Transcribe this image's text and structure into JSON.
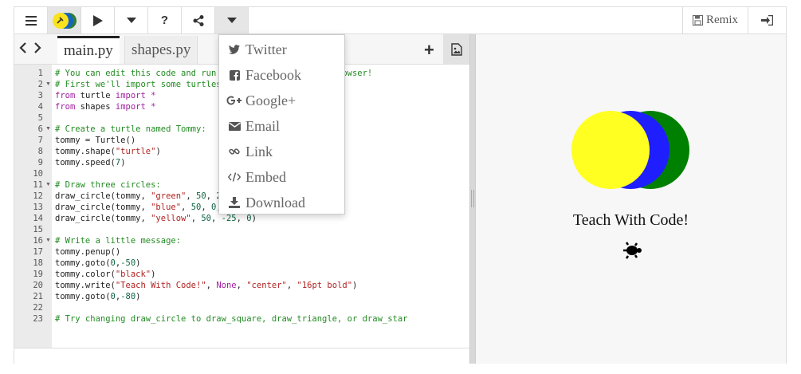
{
  "toolbar": {
    "menu_icon": "hamburger-icon",
    "logo_icon": "python-logo-icon",
    "run_icon": "play-icon",
    "more_icon": "caret-down-icon",
    "help_label": "?",
    "share_icon": "share-icon",
    "share_menu_icon": "caret-down-icon",
    "remix_label": "Remix",
    "login_icon": "sign-in-icon"
  },
  "editor": {
    "nav_icons": [
      "chevron-left-icon",
      "chevron-right-icon"
    ],
    "tabs": [
      {
        "label": "main.py",
        "active": true
      },
      {
        "label": "shapes.py",
        "active": false
      }
    ],
    "add_file_label": "+",
    "image_icon": "image-icon",
    "folded_lines": [
      2,
      6,
      11,
      16
    ],
    "lines": [
      [
        {
          "t": "# You can edit this code and run it right here in your browser!",
          "c": "comment"
        }
      ],
      [
        {
          "t": "# First we'll import some turtles and shapes:",
          "c": "comment"
        }
      ],
      [
        {
          "t": "from",
          "c": "kw"
        },
        {
          "t": " turtle ",
          "c": "plain"
        },
        {
          "t": "import",
          "c": "kw"
        },
        {
          "t": " *",
          "c": "kw"
        }
      ],
      [
        {
          "t": "from",
          "c": "kw"
        },
        {
          "t": " shapes ",
          "c": "plain"
        },
        {
          "t": "import",
          "c": "kw"
        },
        {
          "t": " *",
          "c": "kw"
        }
      ],
      [],
      [
        {
          "t": "# Create a turtle named Tommy:",
          "c": "comment"
        }
      ],
      [
        {
          "t": "tommy = Turtle()",
          "c": "plain"
        }
      ],
      [
        {
          "t": "tommy.shape(",
          "c": "plain"
        },
        {
          "t": "\"turtle\"",
          "c": "str"
        },
        {
          "t": ")",
          "c": "plain"
        }
      ],
      [
        {
          "t": "tommy.speed(",
          "c": "plain"
        },
        {
          "t": "7",
          "c": "num"
        },
        {
          "t": ")",
          "c": "plain"
        }
      ],
      [],
      [
        {
          "t": "# Draw three circles:",
          "c": "comment"
        }
      ],
      [
        {
          "t": "draw_circle(tommy, ",
          "c": "plain"
        },
        {
          "t": "\"green\"",
          "c": "str"
        },
        {
          "t": ", ",
          "c": "plain"
        },
        {
          "t": "50",
          "c": "num"
        },
        {
          "t": ", ",
          "c": "plain"
        },
        {
          "t": "25",
          "c": "num"
        },
        {
          "t": ", ",
          "c": "plain"
        },
        {
          "t": "0",
          "c": "num"
        },
        {
          "t": ")",
          "c": "plain"
        }
      ],
      [
        {
          "t": "draw_circle(tommy, ",
          "c": "plain"
        },
        {
          "t": "\"blue\"",
          "c": "str"
        },
        {
          "t": ", ",
          "c": "plain"
        },
        {
          "t": "50",
          "c": "num"
        },
        {
          "t": ", ",
          "c": "plain"
        },
        {
          "t": "0",
          "c": "num"
        },
        {
          "t": ", ",
          "c": "plain"
        },
        {
          "t": "0",
          "c": "num"
        },
        {
          "t": ")",
          "c": "plain"
        }
      ],
      [
        {
          "t": "draw_circle(tommy, ",
          "c": "plain"
        },
        {
          "t": "\"yellow\"",
          "c": "str"
        },
        {
          "t": ", ",
          "c": "plain"
        },
        {
          "t": "50",
          "c": "num"
        },
        {
          "t": ", ",
          "c": "plain"
        },
        {
          "t": "-25",
          "c": "num"
        },
        {
          "t": ", ",
          "c": "plain"
        },
        {
          "t": "0",
          "c": "num"
        },
        {
          "t": ")",
          "c": "plain"
        }
      ],
      [],
      [
        {
          "t": "# Write a little message:",
          "c": "comment"
        }
      ],
      [
        {
          "t": "tommy.penup()",
          "c": "plain"
        }
      ],
      [
        {
          "t": "tommy.goto(",
          "c": "plain"
        },
        {
          "t": "0",
          "c": "num"
        },
        {
          "t": ",",
          "c": "plain"
        },
        {
          "t": "-50",
          "c": "num"
        },
        {
          "t": ")",
          "c": "plain"
        }
      ],
      [
        {
          "t": "tommy.color(",
          "c": "plain"
        },
        {
          "t": "\"black\"",
          "c": "str"
        },
        {
          "t": ")",
          "c": "plain"
        }
      ],
      [
        {
          "t": "tommy.write(",
          "c": "plain"
        },
        {
          "t": "\"Teach With Code!\"",
          "c": "str"
        },
        {
          "t": ", ",
          "c": "plain"
        },
        {
          "t": "None",
          "c": "kw"
        },
        {
          "t": ", ",
          "c": "plain"
        },
        {
          "t": "\"center\"",
          "c": "str"
        },
        {
          "t": ", ",
          "c": "plain"
        },
        {
          "t": "\"16pt bold\"",
          "c": "str"
        },
        {
          "t": ")",
          "c": "plain"
        }
      ],
      [
        {
          "t": "tommy.goto(",
          "c": "plain"
        },
        {
          "t": "0",
          "c": "num"
        },
        {
          "t": ",",
          "c": "plain"
        },
        {
          "t": "-80",
          "c": "num"
        },
        {
          "t": ")",
          "c": "plain"
        }
      ],
      [],
      [
        {
          "t": "# Try changing draw_circle to draw_square, draw_triangle, or draw_star",
          "c": "comment"
        }
      ]
    ]
  },
  "share_menu": {
    "items": [
      {
        "label": "Twitter",
        "icon": "twitter-icon"
      },
      {
        "label": "Facebook",
        "icon": "facebook-icon"
      },
      {
        "label": "Google+",
        "icon": "google-plus-icon"
      },
      {
        "label": "Email",
        "icon": "email-icon"
      },
      {
        "label": "Link",
        "icon": "link-icon"
      },
      {
        "label": "Embed",
        "icon": "code-icon"
      },
      {
        "label": "Download",
        "icon": "download-icon"
      }
    ]
  },
  "output": {
    "message": "Teach With Code!",
    "circles": [
      {
        "color": "#008000",
        "x": 25
      },
      {
        "color": "#1e1eff",
        "x": 0
      },
      {
        "color": "#ffff22",
        "x": -25
      }
    ],
    "turtle_icon": "turtle-icon"
  },
  "colors": {
    "comment": "#228b22",
    "keyword": "#a020a0",
    "string": "#b22222",
    "number": "#116644"
  }
}
